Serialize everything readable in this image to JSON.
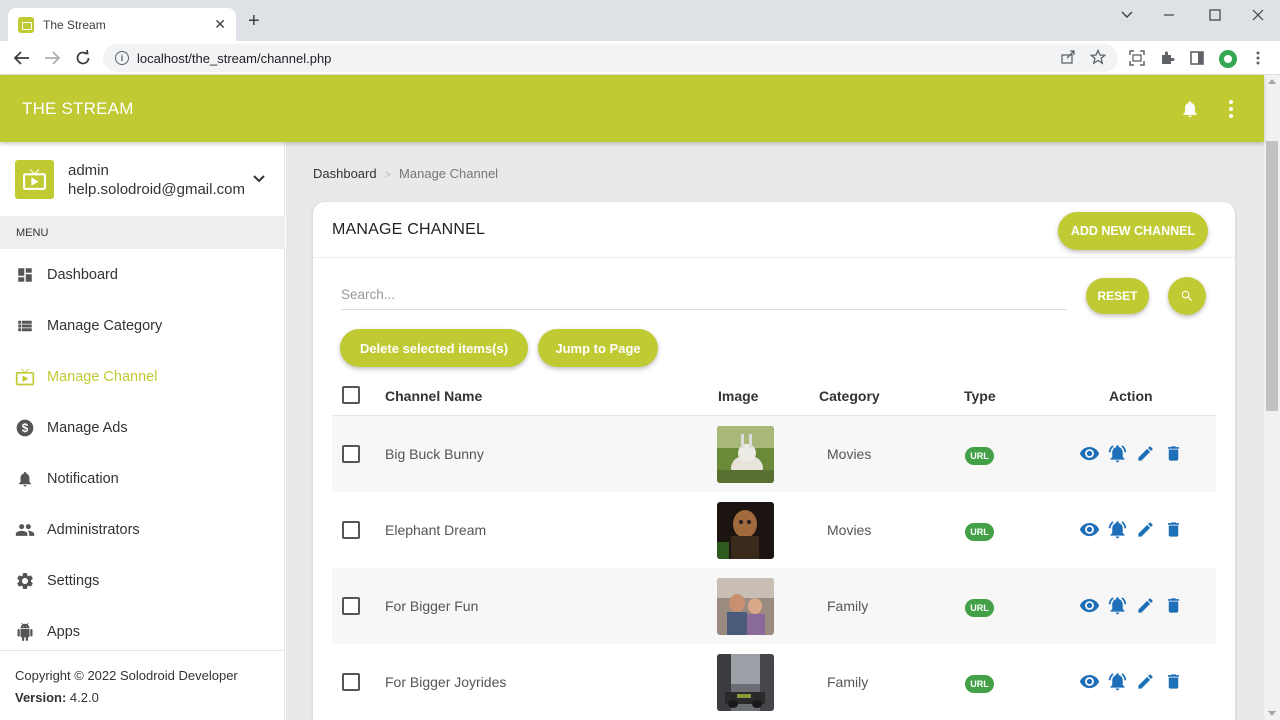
{
  "browser": {
    "tab_title": "The Stream",
    "url": "localhost/the_stream/channel.php",
    "new_tab": "+",
    "close": "✕"
  },
  "app": {
    "title": "THE STREAM"
  },
  "user": {
    "name": "admin",
    "email": "help.solodroid@gmail.com"
  },
  "menu": {
    "header": "MENU",
    "items": [
      {
        "label": "Dashboard",
        "icon": "dashboard-icon",
        "active": false
      },
      {
        "label": "Manage Category",
        "icon": "list-icon",
        "active": false
      },
      {
        "label": "Manage Channel",
        "icon": "tv-icon",
        "active": true
      },
      {
        "label": "Manage Ads",
        "icon": "dollar-icon",
        "active": false
      },
      {
        "label": "Notification",
        "icon": "bell-icon",
        "active": false
      },
      {
        "label": "Administrators",
        "icon": "people-icon",
        "active": false
      },
      {
        "label": "Settings",
        "icon": "gear-icon",
        "active": false
      },
      {
        "label": "Apps",
        "icon": "android-icon",
        "active": false
      }
    ]
  },
  "footer": {
    "copyright": "Copyright © 2022 Solodroid Developer",
    "version_label": "Version:",
    "version_value": "4.2.0"
  },
  "breadcrumb": {
    "home": "Dashboard",
    "separator": ">",
    "current": "Manage Channel"
  },
  "card": {
    "title": "MANAGE CHANNEL",
    "add_button": "ADD NEW CHANNEL",
    "search_placeholder": "Search...",
    "reset_button": "RESET",
    "delete_button": "Delete selected items(s)",
    "jump_button": "Jump to Page"
  },
  "table": {
    "headers": {
      "name": "Channel Name",
      "image": "Image",
      "category": "Category",
      "type": "Type",
      "action": "Action"
    },
    "rows": [
      {
        "name": "Big Buck Bunny",
        "category": "Movies",
        "type": "URL"
      },
      {
        "name": "Elephant Dream",
        "category": "Movies",
        "type": "URL"
      },
      {
        "name": "For Bigger Fun",
        "category": "Family",
        "type": "URL"
      },
      {
        "name": "For Bigger Joyrides",
        "category": "Family",
        "type": "URL"
      }
    ]
  },
  "colors": {
    "brand": "#c0ca33",
    "badge": "#43a047",
    "action": "#1e6fb7"
  }
}
